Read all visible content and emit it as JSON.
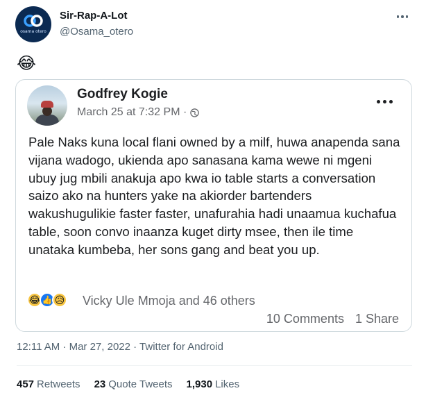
{
  "author": {
    "display_name": "Sir-Rap-A-Lot",
    "handle": "@Osama_otero",
    "avatar_text": "osama otero"
  },
  "tweet": {
    "emoji": "😂"
  },
  "facebook_post": {
    "name": "Godfrey Kogie",
    "timestamp": "March 25 at 7:32 PM ·",
    "visibility_icon": "globe-icon",
    "text": "Pale Naks kuna local flani owned by a milf, huwa anapenda sana vijana wadogo, ukienda apo sanasana kama wewe ni mgeni ubuy jug mbili anakuja apo kwa io table starts a conversation saizo ako na hunters yake na akiorder bartenders wakushugulikie faster faster, unafurahia hadi unaamua kuchafua table, soon convo inaanza kuget dirty msee, then ile time unataka kumbeba, her sons gang and beat you up.",
    "reaction_icons": [
      "😂",
      "👍",
      "😥"
    ],
    "reaction_names": "Vicky Ule Mmoja and 46 others",
    "comments": "10 Comments",
    "shares": "1 Share"
  },
  "meta": {
    "time": "12:11 AM · Mar 27, 2022 · Twitter for Android"
  },
  "stats": {
    "retweets_count": "457",
    "retweets_label": "Retweets",
    "quotes_count": "23",
    "quotes_label": "Quote Tweets",
    "likes_count": "1,930",
    "likes_label": "Likes"
  },
  "colors": {
    "text_primary": "#0f1419",
    "text_secondary": "#536471",
    "fb_blue": "#1877f2",
    "border": "#cfd9de"
  }
}
